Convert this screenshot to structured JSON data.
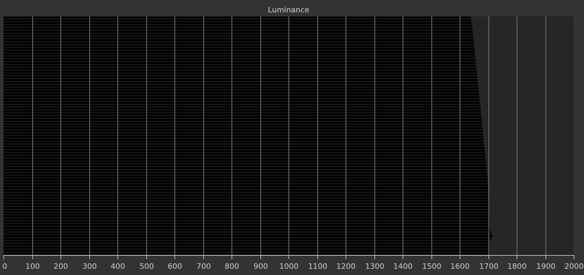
{
  "chart_data": {
    "type": "bar",
    "orientation": "horizontal",
    "title": "Luminance",
    "xlabel": "",
    "ylabel": "",
    "xlim": [
      0,
      2000
    ],
    "xticks": [
      0,
      100,
      200,
      300,
      400,
      500,
      600,
      700,
      800,
      900,
      1000,
      1100,
      1200,
      1300,
      1400,
      1500,
      1600,
      1700,
      1800,
      1900,
      2000
    ],
    "grid": true,
    "legend": "none",
    "colors": {
      "background": "#333333",
      "plot_background": "#262626",
      "bar": "#000000",
      "grid": "#7a7a7a",
      "text": "#d0d0d0"
    },
    "values": [
      1640,
      1641,
      1643,
      1644,
      1645,
      1646,
      1647,
      1648,
      1649,
      1650,
      1651,
      1652,
      1653,
      1654,
      1655,
      1656,
      1657,
      1658,
      1659,
      1660,
      1661,
      1662,
      1663,
      1664,
      1665,
      1666,
      1667,
      1668,
      1669,
      1670,
      1671,
      1672,
      1673,
      1674,
      1675,
      1676,
      1677,
      1678,
      1679,
      1680,
      1681,
      1682,
      1683,
      1684,
      1685,
      1686,
      1687,
      1688,
      1689,
      1690,
      1691,
      1692,
      1693,
      1694,
      1695,
      1696,
      1697,
      1697,
      1698,
      1698,
      1699,
      1699,
      1700,
      1700,
      1701,
      1701,
      1702,
      1702,
      1703,
      1703,
      1704,
      1704,
      1705,
      1705,
      1706,
      1708,
      1712,
      1716,
      1711,
      1705,
      1704,
      1704,
      1704,
      1704
    ]
  }
}
